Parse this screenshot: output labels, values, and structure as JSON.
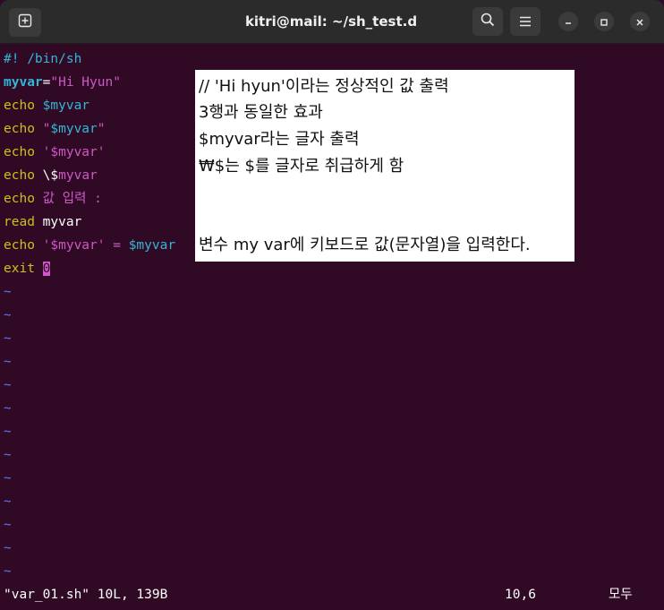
{
  "window": {
    "title": "kitri@mail: ~/sh_test.d",
    "controls": [
      "new-tab-icon",
      "search-icon",
      "hamburger-menu-icon",
      "minimize-icon",
      "maximize-icon",
      "close-icon"
    ]
  },
  "editor": {
    "lines": [
      [
        {
          "t": "#! /bin/sh",
          "c": "cyan"
        }
      ],
      [
        {
          "t": "myvar",
          "c": "cyan bold"
        },
        {
          "t": "=",
          "c": "white"
        },
        {
          "t": "\"Hi Hyun\"",
          "c": "mag"
        }
      ],
      [
        {
          "t": "echo ",
          "c": "yellow"
        },
        {
          "t": "$myvar",
          "c": "cyan"
        }
      ],
      [
        {
          "t": "echo ",
          "c": "yellow"
        },
        {
          "t": "\"",
          "c": "mag"
        },
        {
          "t": "$myvar",
          "c": "cyan"
        },
        {
          "t": "\"",
          "c": "mag"
        }
      ],
      [
        {
          "t": "echo ",
          "c": "yellow"
        },
        {
          "t": "'$myvar'",
          "c": "mag"
        }
      ],
      [
        {
          "t": "echo ",
          "c": "yellow"
        },
        {
          "t": "\\$",
          "c": "white"
        },
        {
          "t": "myvar",
          "c": "mag"
        }
      ],
      [
        {
          "t": "echo ",
          "c": "yellow"
        },
        {
          "t": "값 입력 :",
          "c": "mag"
        }
      ],
      [
        {
          "t": "read ",
          "c": "yellow"
        },
        {
          "t": "myvar",
          "c": "white"
        }
      ],
      [
        {
          "t": "echo ",
          "c": "yellow"
        },
        {
          "t": "'$myvar'",
          "c": "mag"
        },
        {
          "t": " = ",
          "c": "mag"
        },
        {
          "t": "$myvar",
          "c": "cyan"
        }
      ],
      [
        {
          "t": "exit ",
          "c": "yellow"
        },
        {
          "t": "0",
          "c": "cursor"
        }
      ]
    ],
    "tilde": "~",
    "tilde_count": 13
  },
  "status": {
    "file_info": "\"var_01.sh\" 10L, 139B",
    "position": "10,6",
    "mode": "모두"
  },
  "annotation": {
    "lines": [
      "// 'Hi hyun'이라는 정상적인 값 출력",
      "3행과 동일한 효과",
      "$myvar라는 글자 출력",
      "₩$는 $를 글자로 취급하게 함",
      "변수 my var에 키보드로 값(문자열)을 입력한다."
    ]
  },
  "colors": {
    "background": "#300a24",
    "titlebar": "#2b2b2b",
    "cyan": "#35b6d6",
    "yellow": "#c9c21a",
    "magenta": "#cc59c7",
    "tilde": "#5c78ff"
  }
}
